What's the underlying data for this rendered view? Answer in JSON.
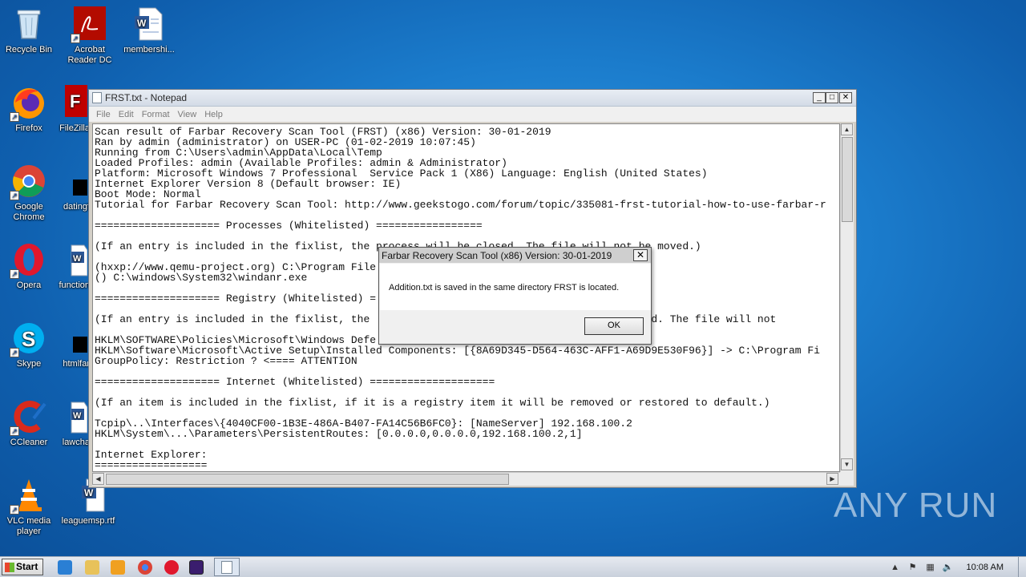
{
  "desktop": {
    "icons": [
      {
        "label": "Recycle Bin"
      },
      {
        "label": "Acrobat Reader DC"
      },
      {
        "label": "membershi..."
      },
      {
        "label": "Firefox"
      },
      {
        "label": "FileZilla"
      },
      {
        "label": "Google Chrome"
      },
      {
        "label": "datingf"
      },
      {
        "label": "Opera"
      },
      {
        "label": "function"
      },
      {
        "label": "Skype"
      },
      {
        "label": "htmlfar"
      },
      {
        "label": "CCleaner"
      },
      {
        "label": "lawcha"
      },
      {
        "label": "VLC media player"
      },
      {
        "label": "leaguemsp.rtf"
      }
    ]
  },
  "notepad": {
    "title": "FRST.txt - Notepad",
    "menu": [
      "File",
      "Edit",
      "Format",
      "View",
      "Help"
    ],
    "content": "Scan result of Farbar Recovery Scan Tool (FRST) (x86) Version: 30-01-2019\nRan by admin (administrator) on USER-PC (01-02-2019 10:07:45)\nRunning from C:\\Users\\admin\\AppData\\Local\\Temp\nLoaded Profiles: admin (Available Profiles: admin & Administrator)\nPlatform: Microsoft Windows 7 Professional  Service Pack 1 (X86) Language: English (United States)\nInternet Explorer Version 8 (Default browser: IE)\nBoot Mode: Normal\nTutorial for Farbar Recovery Scan Tool: http://www.geekstogo.com/forum/topic/335081-frst-tutorial-how-to-use-farbar-r\n\n==================== Processes (Whitelisted) =================\n\n(If an entry is included in the fixlist, the process will be closed. The file will not be moved.)\n\n(hxxp://www.qemu-project.org) C:\\Program File\n() C:\\windows\\System32\\windanr.exe\n\n==================== Registry (Whitelisted) =\n\n(If an entry is included in the fixlist, the                                    or removed. The file will not\n\nHKLM\\SOFTWARE\\Policies\\Microsoft\\Windows Defe\nHKLM\\Software\\Microsoft\\Active Setup\\Installed Components: [{8A69D345-D564-463C-AFF1-A69D9E530F96}] -> C:\\Program Fi\nGroupPolicy: Restriction ? <==== ATTENTION\n\n==================== Internet (Whitelisted) ====================\n\n(If an item is included in the fixlist, if it is a registry item it will be removed or restored to default.)\n\nTcpip\\..\\Interfaces\\{4040CF00-1B3E-486A-B407-FA14C56B6FC0}: [NameServer] 192.168.100.2\nHKLM\\System\\...\\Parameters\\PersistentRoutes: [0.0.0.0,0.0.0.0,192.168.100.2,1]\n\nInternet Explorer:\n=================="
  },
  "dialog": {
    "title": "Farbar Recovery Scan Tool (x86) Version: 30-01-2019",
    "message": "Addition.txt is saved in the same directory FRST is located.",
    "ok_label": "OK",
    "close_glyph": "✕"
  },
  "taskbar": {
    "start_label": "Start",
    "time": "10:08 AM"
  },
  "watermark": "ANY RUN"
}
